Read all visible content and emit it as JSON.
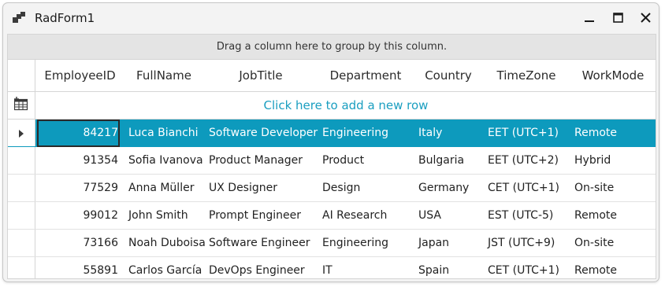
{
  "window": {
    "title": "RadForm1",
    "icons": {
      "app": "radform-app-icon",
      "minimize": "minimize-icon",
      "maximize": "maximize-icon",
      "close": "close-icon"
    }
  },
  "grid": {
    "group_panel_text": "Drag a column here to group by this column.",
    "columns": [
      "EmployeeID",
      "FullName",
      "JobTitle",
      "Department",
      "Country",
      "TimeZone",
      "WorkMode"
    ],
    "new_row_text": "Click here to add a new row",
    "selected_row_index": 0,
    "accent_color": "#0d9abd",
    "rows": [
      [
        "84217",
        "Luca Bianchi",
        "Software Developer",
        "Engineering",
        "Italy",
        "EET (UTC+1)",
        "Remote"
      ],
      [
        "91354",
        "Sofia Ivanova",
        "Product Manager",
        "Product",
        "Bulgaria",
        "EET (UTC+2)",
        "Hybrid"
      ],
      [
        "77529",
        "Anna Müller",
        "UX Designer",
        "Design",
        "Germany",
        "CET (UTC+1)",
        "On-site"
      ],
      [
        "99012",
        "John Smith",
        "Prompt Engineer",
        "AI Research",
        "USA",
        "EST (UTC-5)",
        "Remote"
      ],
      [
        "73166",
        "Noah Duboisa",
        "Software Engineer",
        "Engineering",
        "Japan",
        "JST (UTC+9)",
        "On-site"
      ],
      [
        "55891",
        "Carlos García",
        "DevOps Engineer",
        "IT",
        "Spain",
        "CET (UTC+1)",
        "Remote"
      ]
    ]
  }
}
